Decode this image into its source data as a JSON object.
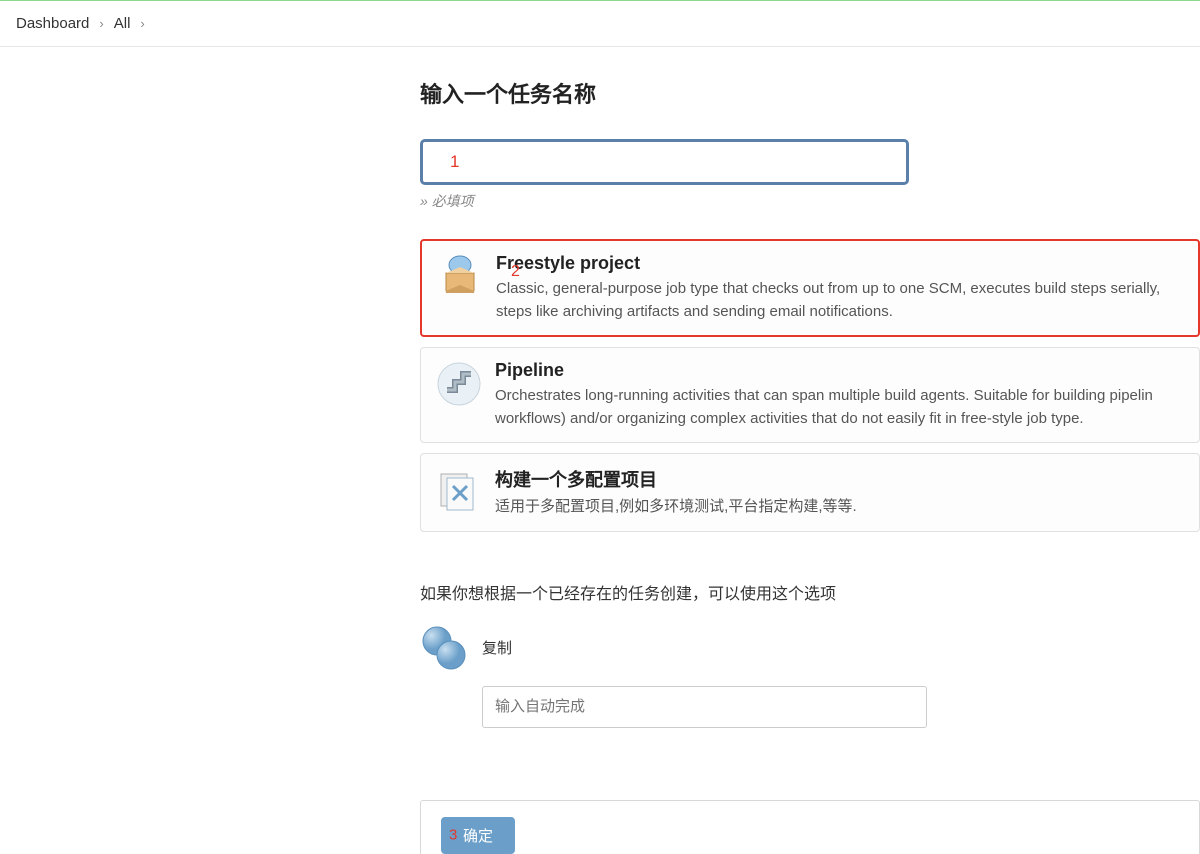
{
  "breadcrumb": {
    "items": [
      "Dashboard",
      "All"
    ]
  },
  "page_title": "输入一个任务名称",
  "name_input": {
    "value": "",
    "placeholder": ""
  },
  "required_note": "» 必填项",
  "annotations": {
    "one": "1",
    "two": "2",
    "three": "3"
  },
  "job_types": [
    {
      "title": "Freestyle project",
      "description": "Classic, general-purpose job type that checks out from up to one SCM, executes build steps serially, steps like archiving artifacts and sending email notifications.",
      "selected": true
    },
    {
      "title": "Pipeline",
      "description": "Orchestrates long-running activities that can span multiple build agents. Suitable for building pipelin workflows) and/or organizing complex activities that do not easily fit in free-style job type.",
      "selected": false
    },
    {
      "title": "构建一个多配置项目",
      "description": "适用于多配置项目,例如多环境测试,平台指定构建,等等.",
      "selected": false
    }
  ],
  "copy_section": {
    "heading": "如果你想根据一个已经存在的任务创建，可以使用这个选项",
    "label": "复制",
    "placeholder": "输入自动完成"
  },
  "ok_button": "确定"
}
